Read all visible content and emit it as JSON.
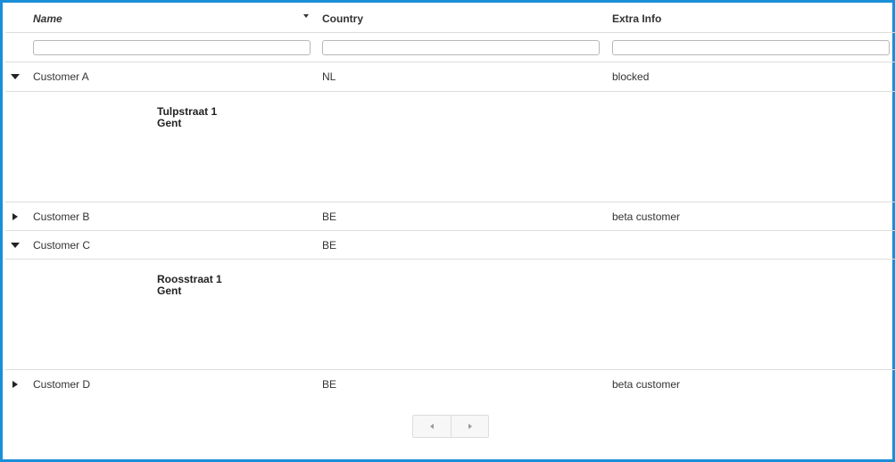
{
  "columns": {
    "name": "Name",
    "country": "Country",
    "extra": "Extra Info"
  },
  "sort": {
    "column": "name",
    "direction": "descending"
  },
  "filters": {
    "name": "",
    "country": "",
    "extra": ""
  },
  "rows": [
    {
      "name": "Customer A",
      "country": "NL",
      "extra": "blocked",
      "expanded": true,
      "detail": {
        "street": "Tulpstraat 1",
        "city": "Gent"
      }
    },
    {
      "name": "Customer B",
      "country": "BE",
      "extra": "beta customer",
      "expanded": false
    },
    {
      "name": "Customer C",
      "country": "BE",
      "extra": "",
      "expanded": true,
      "detail": {
        "street": "Roosstraat 1",
        "city": "Gent"
      }
    },
    {
      "name": "Customer D",
      "country": "BE",
      "extra": "beta customer",
      "expanded": false
    }
  ],
  "icons": {
    "sort": "caret-down-icon",
    "expanded": "triangle-down-icon",
    "collapsed": "triangle-right-icon",
    "pager_prev": "chevron-left-icon",
    "pager_next": "chevron-right-icon"
  },
  "colors": {
    "frame_border": "#1a8fd8",
    "row_border": "#dddddd",
    "text": "#333333"
  }
}
